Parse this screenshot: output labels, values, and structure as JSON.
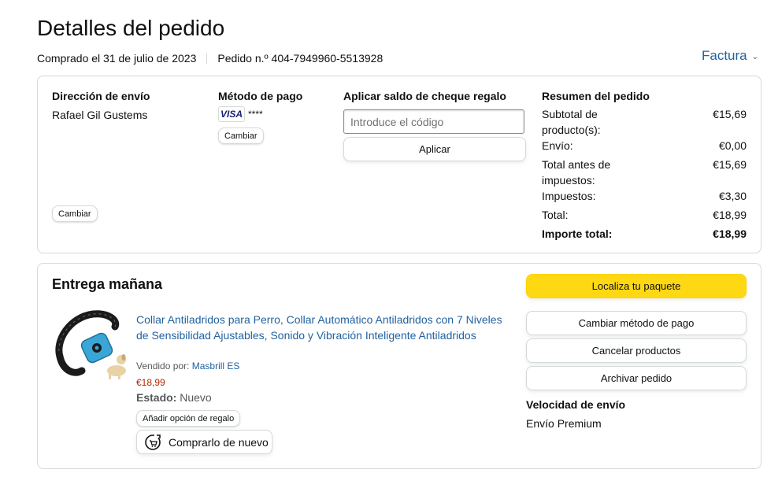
{
  "page": {
    "title": "Detalles del pedido",
    "purchased": "Comprado el 31 de julio de 2023",
    "order_number": "Pedido n.º 404-7949960-5513928",
    "invoice": "Factura"
  },
  "shipping": {
    "title": "Dirección de envío",
    "name": "Rafael Gil Gustems",
    "change_label": "Cambiar"
  },
  "payment": {
    "title": "Método de pago",
    "card_brand": "VISA",
    "card_digits": "****",
    "change_label": "Cambiar"
  },
  "gift": {
    "title": "Aplicar saldo de cheque regalo",
    "placeholder": "Introduce el código",
    "apply_label": "Aplicar"
  },
  "summary": {
    "title": "Resumen del pedido",
    "rows": [
      {
        "label": "Subtotal de producto(s):",
        "value": "€15,69"
      },
      {
        "label": "Envío:",
        "value": "€0,00"
      },
      {
        "label": "Total antes de impuestos:",
        "value": "€15,69"
      },
      {
        "label": "Impuestos:",
        "value": "€3,30"
      },
      {
        "label": "Total:",
        "value": "€18,99"
      },
      {
        "label": "Importe total:",
        "value": "€18,99"
      }
    ]
  },
  "delivery": {
    "title": "Entrega mañana",
    "product_title": "Collar Antiladridos para Perro, Collar Automático Antiladridos con 7 Niveles de Sensibilidad Ajustables, Sonido y Vibración Inteligente Antiladridos",
    "sold_by_label": "Vendido por:",
    "seller": "Masbrill ES",
    "price": "€18,99",
    "status_label": "Estado:",
    "status_value": "Nuevo",
    "gift_option": "Añadir opción de regalo",
    "rebuy": "Comprarlo de nuevo"
  },
  "actions": {
    "track": "Localiza tu paquete",
    "change_payment": "Cambiar método de pago",
    "cancel": "Cancelar productos",
    "archive": "Archivar pedido"
  },
  "shipping_speed": {
    "title": "Velocidad de envío",
    "value": "Envío Premium"
  },
  "colors": {
    "link": "#2162a1",
    "price": "#b12704",
    "primary_button": "#ffd814",
    "collar_blue": "#3aa6d8"
  }
}
